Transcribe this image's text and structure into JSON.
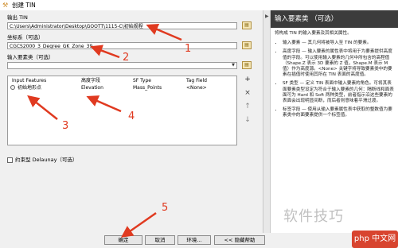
{
  "window": {
    "title": "创建 TIN"
  },
  "form": {
    "output_label": "输出 TIN",
    "output_value": "C:\\Users\\Administrator\\Desktop\\GOOTT\\1115-C\\初始规程",
    "crs_label": "坐标系（可选）",
    "crs_value": "CGCS2000_3_Degree_GK_Zone_39",
    "input_features_label": "输入要素类（可选）",
    "input_features_value": "",
    "constrained_label": "约束型 Delaunay（可选）"
  },
  "table": {
    "headers": [
      "Input Features",
      "高度字段",
      "SF Type",
      "Tag Field"
    ],
    "rows": [
      {
        "input": "初始地形点",
        "height": "Elevation",
        "sftype": "Mass_Points",
        "tag": "<None>"
      }
    ]
  },
  "side_buttons": [
    "+",
    "×",
    "↑",
    "↓"
  ],
  "help": {
    "title": "输入要素类 （可选）",
    "intro": "将构成 TIN 的输入要素及其相关属性。",
    "items": [
      "输入要素 — 其几何将被导入至 TIN 的要素。",
      "高度字段 — 输入要素的属性表中将用于为要素提供高度值的字段。可以使用输入要素的几何中所包含的高程值（Shape.Z 表示 3D 要素的 Z 值，Shape.M 表示 M 值）作为高度源。<None> 关键字将导致要素类中的要素在插值时使用其所在 TIN 表面的高度值。",
      "SF 类型 — 定义 TIN 表面中输入要素的角色。可将其表面要素类型设定为符合于输入要素的几何：隔断线和面表面可为 Hard 和 Soft 两种类型，前者指示沿这些要素的表面会出现明显间断，而后者则意味着平滑过渡。",
      "标签字段 — 使用从输入要素属性表中获取的整数值为要素类中的面要素提供一个标签值。"
    ]
  },
  "annotations": [
    "1",
    "2",
    "3",
    "4",
    "5"
  ],
  "buttons": {
    "ok": "确定",
    "cancel": "取消",
    "env": "环境...",
    "hide_help": "<< 隐藏帮助"
  },
  "watermark": "软件技巧",
  "badge": "php 中文网",
  "colors": {
    "annotation": "#e03a20",
    "help_header": "#3c3c3c"
  }
}
